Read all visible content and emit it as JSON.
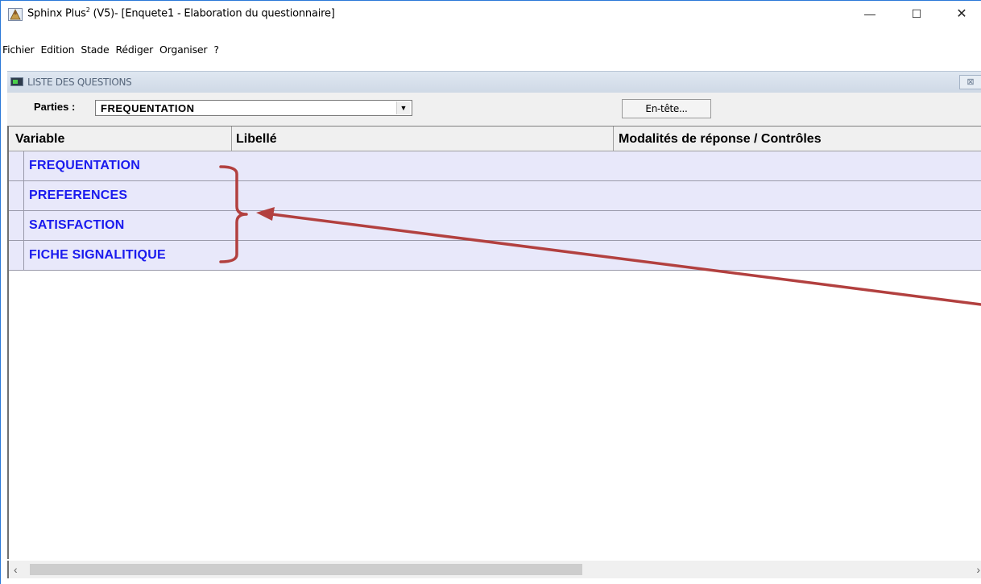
{
  "window": {
    "app_name": "Sphinx Plus",
    "app_superscript": "2",
    "title_rest": " (V5)- [Enquete1 - Elaboration du questionnaire]",
    "minimize_glyph": "—",
    "maximize_glyph": "☐",
    "close_glyph": "✕"
  },
  "menu": [
    "Fichier",
    "Edition",
    "Stade",
    "Rédiger",
    "Organiser",
    "?"
  ],
  "mdi": {
    "title": "LISTE DES QUESTIONS",
    "close_glyph": "⊠"
  },
  "toolbar": {
    "parties_label": "Parties :",
    "parties_value": "FREQUENTATION",
    "combo_arrow": "▼",
    "entete_label": "En-tête..."
  },
  "grid": {
    "columns": [
      "Variable",
      "Libellé",
      "Modalités de réponse / Contrôles"
    ],
    "rows": [
      "FREQUENTATION",
      "PREFERENCES",
      "SATISFACTION",
      "FICHE SIGNALITIQUE"
    ]
  },
  "scrollbar": {
    "left_glyph": "‹",
    "right_glyph": "›"
  },
  "colors": {
    "row_bg": "#e8e8fa",
    "row_text": "#1a1aee",
    "annotation": "#b2403f",
    "window_border": "#2b79d8"
  }
}
